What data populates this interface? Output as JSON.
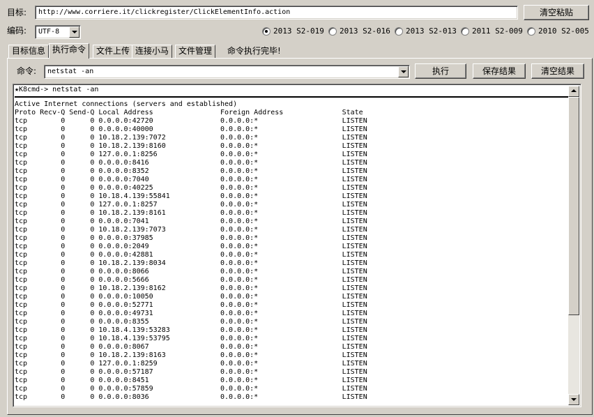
{
  "target": {
    "label": "目标:",
    "url": "http://www.corriere.it/clickregister/ClickElementInfo.action",
    "clear_paste_label": "清空粘贴"
  },
  "encoding": {
    "label": "编码:",
    "value": "UTF-8"
  },
  "exploits": [
    {
      "label": "2013 S2-019",
      "selected": true
    },
    {
      "label": "2013 S2-016",
      "selected": false
    },
    {
      "label": "2013 S2-013",
      "selected": false
    },
    {
      "label": "2011 S2-009",
      "selected": false
    },
    {
      "label": "2010 S2-005",
      "selected": false
    }
  ],
  "tabs": [
    "目标信息",
    "执行命令",
    "文件上传",
    "连接小马",
    "文件管理"
  ],
  "active_tab": 1,
  "status": "命令执行完毕!",
  "command": {
    "label": "命令:",
    "value": "netstat -an",
    "exec_label": "执行",
    "save_label": "保存结果",
    "clear_label": "清空结果"
  },
  "output": {
    "prompt": "★K8cmd-> netstat -an",
    "heading": "Active Internet connections (servers and established)",
    "columns": [
      "Proto",
      "Recv-Q",
      "Send-Q",
      "Local Address",
      "Foreign Address",
      "State"
    ],
    "rows": [
      [
        "tcp",
        "0",
        "0",
        "0.0.0.0:42720",
        "0.0.0.0:*",
        "LISTEN"
      ],
      [
        "tcp",
        "0",
        "0",
        "0.0.0.0:40000",
        "0.0.0.0:*",
        "LISTEN"
      ],
      [
        "tcp",
        "0",
        "0",
        "10.18.2.139:7072",
        "0.0.0.0:*",
        "LISTEN"
      ],
      [
        "tcp",
        "0",
        "0",
        "10.18.2.139:8160",
        "0.0.0.0:*",
        "LISTEN"
      ],
      [
        "tcp",
        "0",
        "0",
        "127.0.0.1:8256",
        "0.0.0.0:*",
        "LISTEN"
      ],
      [
        "tcp",
        "0",
        "0",
        "0.0.0.0:8416",
        "0.0.0.0:*",
        "LISTEN"
      ],
      [
        "tcp",
        "0",
        "0",
        "0.0.0.0:8352",
        "0.0.0.0:*",
        "LISTEN"
      ],
      [
        "tcp",
        "0",
        "0",
        "0.0.0.0:7040",
        "0.0.0.0:*",
        "LISTEN"
      ],
      [
        "tcp",
        "0",
        "0",
        "0.0.0.0:40225",
        "0.0.0.0:*",
        "LISTEN"
      ],
      [
        "tcp",
        "0",
        "0",
        "10.18.4.139:55841",
        "0.0.0.0:*",
        "LISTEN"
      ],
      [
        "tcp",
        "0",
        "0",
        "127.0.0.1:8257",
        "0.0.0.0:*",
        "LISTEN"
      ],
      [
        "tcp",
        "0",
        "0",
        "10.18.2.139:8161",
        "0.0.0.0:*",
        "LISTEN"
      ],
      [
        "tcp",
        "0",
        "0",
        "0.0.0.0:7041",
        "0.0.0.0:*",
        "LISTEN"
      ],
      [
        "tcp",
        "0",
        "0",
        "10.18.2.139:7073",
        "0.0.0.0:*",
        "LISTEN"
      ],
      [
        "tcp",
        "0",
        "0",
        "0.0.0.0:37985",
        "0.0.0.0:*",
        "LISTEN"
      ],
      [
        "tcp",
        "0",
        "0",
        "0.0.0.0:2049",
        "0.0.0.0:*",
        "LISTEN"
      ],
      [
        "tcp",
        "0",
        "0",
        "0.0.0.0:42881",
        "0.0.0.0:*",
        "LISTEN"
      ],
      [
        "tcp",
        "0",
        "0",
        "10.18.2.139:8034",
        "0.0.0.0:*",
        "LISTEN"
      ],
      [
        "tcp",
        "0",
        "0",
        "0.0.0.0:8066",
        "0.0.0.0:*",
        "LISTEN"
      ],
      [
        "tcp",
        "0",
        "0",
        "0.0.0.0:5666",
        "0.0.0.0:*",
        "LISTEN"
      ],
      [
        "tcp",
        "0",
        "0",
        "10.18.2.139:8162",
        "0.0.0.0:*",
        "LISTEN"
      ],
      [
        "tcp",
        "0",
        "0",
        "0.0.0.0:10050",
        "0.0.0.0:*",
        "LISTEN"
      ],
      [
        "tcp",
        "0",
        "0",
        "0.0.0.0:52771",
        "0.0.0.0:*",
        "LISTEN"
      ],
      [
        "tcp",
        "0",
        "0",
        "0.0.0.0:49731",
        "0.0.0.0:*",
        "LISTEN"
      ],
      [
        "tcp",
        "0",
        "0",
        "0.0.0.0:8355",
        "0.0.0.0:*",
        "LISTEN"
      ],
      [
        "tcp",
        "0",
        "0",
        "10.18.4.139:53283",
        "0.0.0.0:*",
        "LISTEN"
      ],
      [
        "tcp",
        "0",
        "0",
        "10.18.4.139:53795",
        "0.0.0.0:*",
        "LISTEN"
      ],
      [
        "tcp",
        "0",
        "0",
        "0.0.0.0:8067",
        "0.0.0.0:*",
        "LISTEN"
      ],
      [
        "tcp",
        "0",
        "0",
        "10.18.2.139:8163",
        "0.0.0.0:*",
        "LISTEN"
      ],
      [
        "tcp",
        "0",
        "0",
        "127.0.0.1:8259",
        "0.0.0.0:*",
        "LISTEN"
      ],
      [
        "tcp",
        "0",
        "0",
        "0.0.0.0:57187",
        "0.0.0.0:*",
        "LISTEN"
      ],
      [
        "tcp",
        "0",
        "0",
        "0.0.0.0:8451",
        "0.0.0.0:*",
        "LISTEN"
      ],
      [
        "tcp",
        "0",
        "0",
        "0.0.0.0:57859",
        "0.0.0.0:*",
        "LISTEN"
      ],
      [
        "tcp",
        "0",
        "0",
        "0.0.0.0:8036",
        "0.0.0.0:*",
        "LISTEN"
      ]
    ]
  }
}
